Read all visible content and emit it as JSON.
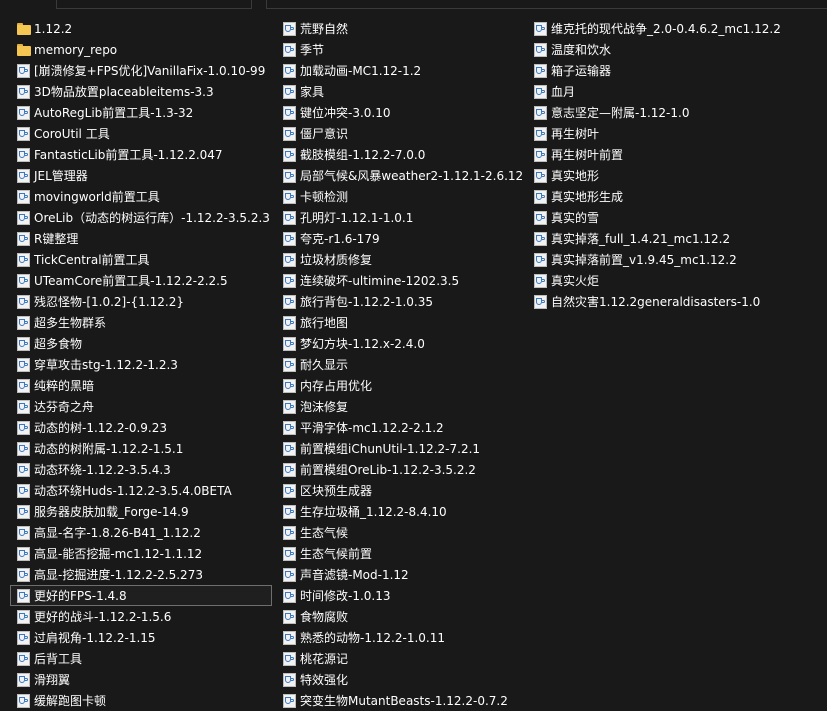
{
  "columns": [
    [
      {
        "label": "1.12.2",
        "icon": "folder-icon"
      },
      {
        "label": "memory_repo",
        "icon": "folder-icon"
      },
      {
        "label": "[崩溃修复+FPS优化]VanillaFix-1.0.10-99",
        "icon": "jar-file-icon"
      },
      {
        "label": "3D物品放置placeableitems-3.3",
        "icon": "jar-file-icon"
      },
      {
        "label": "AutoRegLib前置工具-1.3-32",
        "icon": "jar-file-icon"
      },
      {
        "label": "CoroUtil 工具",
        "icon": "jar-file-icon"
      },
      {
        "label": "FantasticLib前置工具-1.12.2.047",
        "icon": "jar-file-icon"
      },
      {
        "label": "JEL管理器",
        "icon": "jar-file-icon"
      },
      {
        "label": "movingworld前置工具",
        "icon": "jar-file-icon"
      },
      {
        "label": "OreLib（动态的树运行库）-1.12.2-3.5.2.3",
        "icon": "jar-file-icon"
      },
      {
        "label": "R键整理",
        "icon": "jar-file-icon"
      },
      {
        "label": "TickCentral前置工具",
        "icon": "jar-file-icon"
      },
      {
        "label": "UTeamCore前置工具-1.12.2-2.2.5",
        "icon": "jar-file-icon"
      },
      {
        "label": "残忍怪物-[1.0.2]-{1.12.2}",
        "icon": "jar-file-icon"
      },
      {
        "label": "超多生物群系",
        "icon": "jar-file-icon"
      },
      {
        "label": "超多食物",
        "icon": "jar-file-icon"
      },
      {
        "label": "穿草攻击stg-1.12.2-1.2.3",
        "icon": "jar-file-icon"
      },
      {
        "label": "纯粹的黑暗",
        "icon": "jar-file-icon"
      },
      {
        "label": "达芬奇之舟",
        "icon": "jar-file-icon"
      },
      {
        "label": "动态的树-1.12.2-0.9.23",
        "icon": "jar-file-icon"
      },
      {
        "label": "动态的树附属-1.12.2-1.5.1",
        "icon": "jar-file-icon"
      },
      {
        "label": "动态环绕-1.12.2-3.5.4.3",
        "icon": "jar-file-icon"
      },
      {
        "label": "动态环绕Huds-1.12.2-3.5.4.0BETA",
        "icon": "jar-file-icon"
      },
      {
        "label": "服务器皮肤加载_Forge-14.9",
        "icon": "jar-file-icon"
      },
      {
        "label": "高显-名字-1.8.26-B41_1.12.2",
        "icon": "jar-file-icon"
      },
      {
        "label": "高显-能否挖掘-mc1.12-1.1.12",
        "icon": "jar-file-icon"
      },
      {
        "label": "高显-挖掘进度-1.12.2-2.5.273",
        "icon": "jar-file-icon"
      },
      {
        "label": "更好的FPS-1.4.8",
        "icon": "jar-file-icon",
        "selected": true
      },
      {
        "label": "更好的战斗-1.12.2-1.5.6",
        "icon": "jar-file-icon"
      },
      {
        "label": "过肩视角-1.12.2-1.15",
        "icon": "jar-file-icon"
      },
      {
        "label": "后背工具",
        "icon": "jar-file-icon"
      },
      {
        "label": "滑翔翼",
        "icon": "jar-file-icon"
      },
      {
        "label": "缓解跑图卡顿",
        "icon": "jar-file-icon"
      }
    ],
    [
      {
        "label": "荒野自然",
        "icon": "jar-file-icon"
      },
      {
        "label": "季节",
        "icon": "jar-file-icon"
      },
      {
        "label": "加载动画-MC1.12-1.2",
        "icon": "jar-file-icon"
      },
      {
        "label": "家具",
        "icon": "jar-file-icon"
      },
      {
        "label": "键位冲突-3.0.10",
        "icon": "jar-file-icon"
      },
      {
        "label": "僵尸意识",
        "icon": "jar-file-icon"
      },
      {
        "label": "截肢模组-1.12.2-7.0.0",
        "icon": "jar-file-icon"
      },
      {
        "label": "局部气候&风暴weather2-1.12.1-2.6.12",
        "icon": "jar-file-icon"
      },
      {
        "label": "卡顿检测",
        "icon": "jar-file-icon"
      },
      {
        "label": "孔明灯-1.12.1-1.0.1",
        "icon": "jar-file-icon"
      },
      {
        "label": "夸克-r1.6-179",
        "icon": "jar-file-icon"
      },
      {
        "label": "垃圾材质修复",
        "icon": "jar-file-icon"
      },
      {
        "label": "连续破坏-ultimine-1202.3.5",
        "icon": "jar-file-icon"
      },
      {
        "label": "旅行背包-1.12.2-1.0.35",
        "icon": "jar-file-icon"
      },
      {
        "label": "旅行地图",
        "icon": "jar-file-icon"
      },
      {
        "label": "梦幻方块-1.12.x-2.4.0",
        "icon": "jar-file-icon"
      },
      {
        "label": "耐久显示",
        "icon": "jar-file-icon"
      },
      {
        "label": "内存占用优化",
        "icon": "jar-file-icon"
      },
      {
        "label": "泡沫修复",
        "icon": "jar-file-icon"
      },
      {
        "label": "平滑字体-mc1.12.2-2.1.2",
        "icon": "jar-file-icon"
      },
      {
        "label": "前置模组iChunUtil-1.12.2-7.2.1",
        "icon": "jar-file-icon"
      },
      {
        "label": "前置模组OreLib-1.12.2-3.5.2.2",
        "icon": "jar-file-icon"
      },
      {
        "label": "区块预生成器",
        "icon": "jar-file-icon"
      },
      {
        "label": "生存垃圾桶_1.12.2-8.4.10",
        "icon": "jar-file-icon"
      },
      {
        "label": "生态气候",
        "icon": "jar-file-icon"
      },
      {
        "label": "生态气候前置",
        "icon": "jar-file-icon"
      },
      {
        "label": "声音滤镜-Mod-1.12",
        "icon": "jar-file-icon"
      },
      {
        "label": "时间修改-1.0.13",
        "icon": "jar-file-icon"
      },
      {
        "label": "食物腐败",
        "icon": "jar-file-icon"
      },
      {
        "label": "熟悉的动物-1.12.2-1.0.11",
        "icon": "jar-file-icon"
      },
      {
        "label": "桃花源记",
        "icon": "jar-file-icon"
      },
      {
        "label": "特效强化",
        "icon": "jar-file-icon"
      },
      {
        "label": "突变生物MutantBeasts-1.12.2-0.7.2",
        "icon": "jar-file-icon"
      }
    ],
    [
      {
        "label": "维克托的现代战争_2.0-0.4.6.2_mc1.12.2",
        "icon": "jar-file-icon"
      },
      {
        "label": "温度和饮水",
        "icon": "jar-file-icon"
      },
      {
        "label": "箱子运输器",
        "icon": "jar-file-icon"
      },
      {
        "label": "血月",
        "icon": "jar-file-icon"
      },
      {
        "label": "意志坚定—附属-1.12-1.0",
        "icon": "jar-file-icon"
      },
      {
        "label": "再生树叶",
        "icon": "jar-file-icon"
      },
      {
        "label": "再生树叶前置",
        "icon": "jar-file-icon"
      },
      {
        "label": "真实地形",
        "icon": "jar-file-icon"
      },
      {
        "label": "真实地形生成",
        "icon": "jar-file-icon"
      },
      {
        "label": "真实的雪",
        "icon": "jar-file-icon"
      },
      {
        "label": "真实掉落_full_1.4.21_mc1.12.2",
        "icon": "jar-file-icon"
      },
      {
        "label": "真实掉落前置_v1.9.45_mc1.12.2",
        "icon": "jar-file-icon"
      },
      {
        "label": "真实火炬",
        "icon": "jar-file-icon"
      },
      {
        "label": "自然灾害1.12.2generaldisasters-1.0",
        "icon": "jar-file-icon"
      }
    ]
  ]
}
